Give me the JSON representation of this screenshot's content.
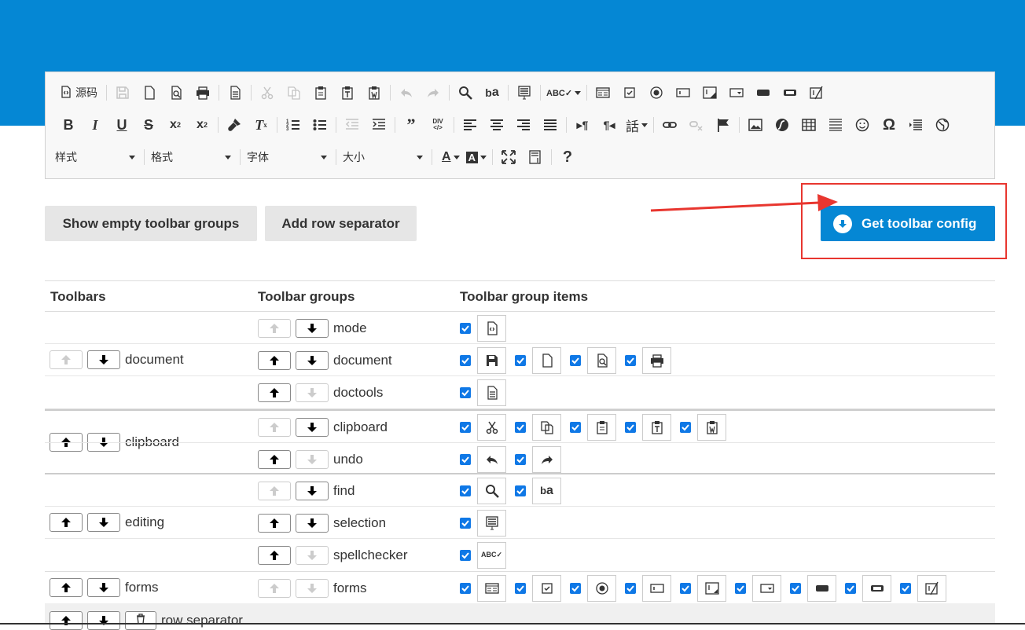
{
  "editor_toolbar": {
    "source_label": "源码",
    "combos": [
      "样式",
      "格式",
      "字体",
      "大小"
    ]
  },
  "buttons": {
    "show_empty": "Show empty toolbar groups",
    "add_row_sep": "Add row separator",
    "get_config": "Get toolbar config"
  },
  "table": {
    "headers": [
      "Toolbars",
      "Toolbar groups",
      "Toolbar group items"
    ],
    "toolbars": [
      {
        "name": "document",
        "groups": [
          {
            "name": "mode",
            "items": [
              "source-icon"
            ]
          },
          {
            "name": "document",
            "items": [
              "save-icon",
              "new-page-icon",
              "preview-icon",
              "print-icon"
            ]
          },
          {
            "name": "doctools",
            "items": [
              "templates-icon"
            ]
          }
        ]
      },
      {
        "name": "clipboard",
        "groups": [
          {
            "name": "clipboard",
            "items": [
              "cut-icon",
              "copy-icon",
              "paste-icon",
              "paste-text-icon",
              "paste-word-icon"
            ]
          },
          {
            "name": "undo",
            "items": [
              "undo-icon",
              "redo-icon"
            ]
          }
        ]
      },
      {
        "name": "editing",
        "groups": [
          {
            "name": "find",
            "items": [
              "find-icon",
              "replace-icon"
            ]
          },
          {
            "name": "selection",
            "items": [
              "select-all-icon"
            ]
          },
          {
            "name": "spellchecker",
            "items": [
              "spellcheck-icon"
            ]
          }
        ]
      },
      {
        "name": "forms",
        "groups": [
          {
            "name": "forms",
            "items": [
              "form-icon",
              "checkbox-icon",
              "radio-icon",
              "textfield-icon",
              "textarea-icon",
              "select-icon",
              "button-icon",
              "image-button-icon",
              "hidden-field-icon"
            ]
          }
        ]
      }
    ],
    "row_separator_label": "row separator"
  }
}
